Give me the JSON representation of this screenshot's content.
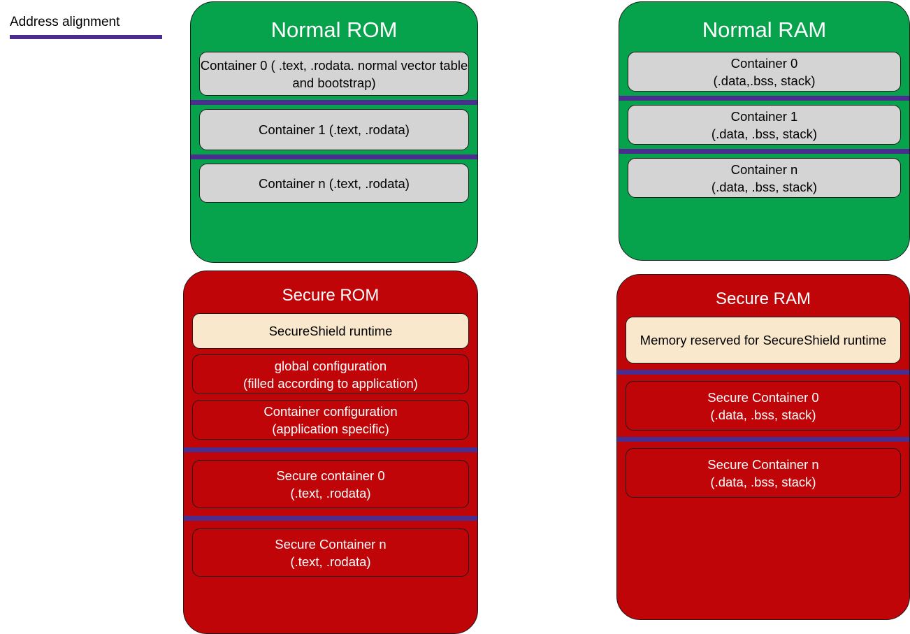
{
  "legend": {
    "label": "Address alignment",
    "bar_color": "#4A2D8F"
  },
  "colors": {
    "normal_region": "#07A24C",
    "secure_region": "#C00508",
    "normal_slot": "#d4d4d4",
    "runtime_slot": "#FAE8CC",
    "alignment_bar": "#4A2D8F",
    "title_text": "#FFFFFF",
    "outline": "#1A1A1A"
  },
  "regions": {
    "normal_rom": {
      "title": "Normal ROM",
      "slots": [
        {
          "text": "Container 0 ( .text, .rodata. normal vector table and bootstrap)"
        },
        {
          "text": "Container 1 (.text, .rodata)"
        },
        {
          "text": "Container n (.text, .rodata)"
        }
      ]
    },
    "normal_ram": {
      "title": "Normal RAM",
      "slots": [
        {
          "line1": "Container 0",
          "line2": "(.data,.bss, stack)"
        },
        {
          "line1": "Container 1",
          "line2": "(.data, .bss, stack)"
        },
        {
          "line1": "Container n",
          "line2": "(.data, .bss, stack)"
        }
      ]
    },
    "secure_rom": {
      "title": "Secure ROM",
      "slots": [
        {
          "line1": "SecureShield runtime",
          "line2": ""
        },
        {
          "line1": "global configuration",
          "line2": "(filled according to application)"
        },
        {
          "line1": "Container configuration",
          "line2": "(application specific)"
        },
        {
          "line1": "Secure container 0",
          "line2": "(.text, .rodata)"
        },
        {
          "line1": "Secure Container n",
          "line2": "(.text, .rodata)"
        }
      ]
    },
    "secure_ram": {
      "title": "Secure RAM",
      "slots": [
        {
          "line1": "Memory reserved for SecureShield runtime",
          "line2": ""
        },
        {
          "line1": "Secure Container 0",
          "line2": "(.data, .bss, stack)"
        },
        {
          "line1": "Secure Container n",
          "line2": "(.data, .bss, stack)"
        }
      ]
    }
  }
}
